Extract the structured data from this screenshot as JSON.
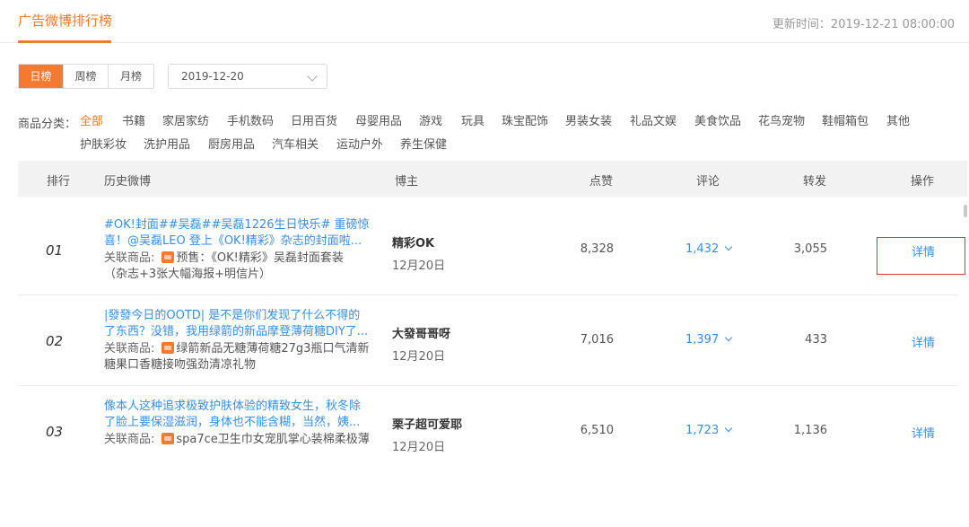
{
  "header": {
    "title": "广告微博排行榜",
    "updated": "更新时间：2019-12-21 08:00:00"
  },
  "tabs": [
    {
      "label": "日榜",
      "active": true
    },
    {
      "label": "周榜",
      "active": false
    },
    {
      "label": "月榜",
      "active": false
    }
  ],
  "date_select": {
    "value": "2019-12-20"
  },
  "categories": {
    "label": "商品分类：",
    "items": [
      "全部",
      "书籍",
      "家居家纺",
      "手机数码",
      "日用百货",
      "母婴用品",
      "游戏",
      "玩具",
      "珠宝配饰",
      "男装女装",
      "礼品文娱",
      "美食饮品",
      "花鸟宠物",
      "鞋帽箱包",
      "其他",
      "护肤彩妆",
      "洗护用品",
      "厨房用品",
      "汽车相关",
      "运动户外",
      "养生保健"
    ]
  },
  "table": {
    "headers": {
      "rank": "排行",
      "post": "历史微博",
      "blogger": "博主",
      "likes": "点赞",
      "comments": "评论",
      "reposts": "转发",
      "actions": "操作"
    },
    "product_label": "关联商品:",
    "rows": [
      {
        "rank": "01",
        "title_line1": "#OK!封面##吴磊##吴磊1226生日快乐# 重磅惊",
        "title_line2": "喜！@吴磊LEO 登上《OK!精彩》杂志的封面啦...",
        "product_line1": "预售：《OK!精彩》吴磊封面套装",
        "product_line2": "（杂志+3张大幅海报+明信片）",
        "blogger": "精彩OK",
        "date": "12月20日",
        "likes": "8,328",
        "comments": "1,432",
        "reposts": "3,055",
        "action": "详情"
      },
      {
        "rank": "02",
        "title_line1": "|發發今日的OOTD| 是不是你们发现了什么不得的",
        "title_line2": "了东西？没错，我用绿箭的新品摩登薄荷糖DIY了...",
        "product_line1": "绿箭新品无糖薄荷糖27g3瓶口气清新",
        "product_line2": "糖果口香糖接吻强劲清凉礼物",
        "blogger": "大發哥哥呀",
        "date": "12月20日",
        "likes": "7,016",
        "comments": "1,397",
        "reposts": "433",
        "action": "详情"
      },
      {
        "rank": "03",
        "title_line1": "像本人这种追求极致护肤体验的精致女生，秋冬除",
        "title_line2": "了脸上要保湿滋润，身体也不能含糊，当然，姨...",
        "product_line1": "spa7ce卫生巾女宠肌掌心装棉柔极薄",
        "product_line2": "",
        "blogger": "栗子超可爱耶",
        "date": "12月20日",
        "likes": "6,510",
        "comments": "1,723",
        "reposts": "1,136",
        "action": "详情"
      }
    ]
  },
  "colors": {
    "accent": "#f47a2f",
    "link": "#3a8ee6",
    "highlight_border": "#d9363e"
  }
}
